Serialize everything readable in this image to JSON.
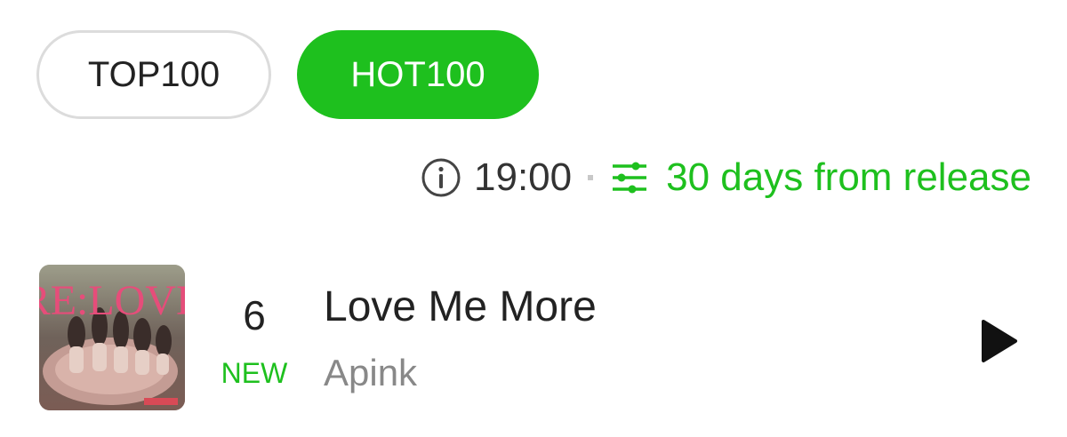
{
  "tabs": [
    {
      "label": "TOP100",
      "active": false
    },
    {
      "label": "HOT100",
      "active": true
    }
  ],
  "info": {
    "time": "19:00",
    "filter_label": "30 days from release"
  },
  "track": {
    "rank": "6",
    "rank_change": "NEW",
    "title": "Love Me More",
    "artist": "Apink",
    "album_art_text": "RE:LOVE"
  },
  "colors": {
    "accent": "#1ec01e",
    "text_primary": "#222222",
    "text_secondary": "#888888"
  },
  "icons": {
    "info": "info-circle-icon",
    "filter": "sliders-icon",
    "play": "play-icon"
  }
}
